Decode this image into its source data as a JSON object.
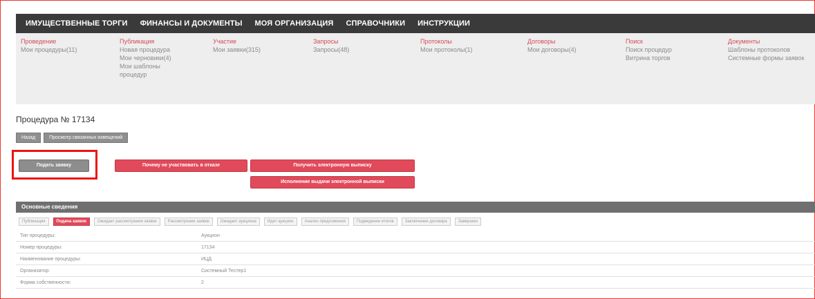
{
  "nav": {
    "items": [
      "ИМУЩЕСТВЕННЫЕ ТОРГИ",
      "ФИНАНСЫ И ДОКУМЕНТЫ",
      "МОЯ ОРГАНИЗАЦИЯ",
      "СПРАВОЧНИКИ",
      "ИНСТРУКЦИИ"
    ]
  },
  "submenu": {
    "columns": [
      {
        "head": "Проведение",
        "items": [
          "Мои процедуры(11)"
        ]
      },
      {
        "head": "Публикация",
        "items": [
          "Новая процедура",
          "Мои черновики(4)",
          "Мои шаблоны процедур"
        ]
      },
      {
        "head": "Участие",
        "items": [
          "Мои заявки(315)"
        ]
      },
      {
        "head": "Запросы",
        "items": [
          "Запросы(48)"
        ]
      },
      {
        "head": "Протоколы",
        "items": [
          "Мои протоколы(1)"
        ]
      },
      {
        "head": "Договоры",
        "items": [
          "Мои договоры(4)"
        ]
      },
      {
        "head": "Поиск",
        "items": [
          "Поиск процедур",
          "Витрина торгов"
        ]
      },
      {
        "head": "Документы",
        "items": [
          "Шаблоны протоколов",
          "Системные формы заявок"
        ]
      }
    ]
  },
  "page": {
    "title": "Процедура № 17134"
  },
  "tabs": [
    "Назад",
    "Просмотр связанных извещений"
  ],
  "buttons": {
    "submit": "Подать заявку",
    "participate": "Почему не участвовать в отказе",
    "get_docs": "Получить электронную выписку",
    "issue_docs": "Исполнение выдачи электронной выписки"
  },
  "section": {
    "header": "Основные сведения"
  },
  "stages": [
    "Публикация",
    "Подача заявок",
    "Ожидает рассмотрения заявок",
    "Рассмотрение заявок",
    "Ожидает аукциона",
    "Идет аукцион",
    "Анализ предложения",
    "Подведение итогов",
    "Заключение договора",
    "Завершен"
  ],
  "active_stage_index": 1,
  "info_rows": [
    {
      "key": "Тип процедуры:",
      "value": "Аукцион"
    },
    {
      "key": "Номер процедуры:",
      "value": "17134"
    },
    {
      "key": "Наименование процедуры:",
      "value": "ИЦД"
    },
    {
      "key": "Организатор:",
      "value": "Системный Тестер1"
    },
    {
      "key": "Форма собственности:",
      "value": "2"
    }
  ]
}
